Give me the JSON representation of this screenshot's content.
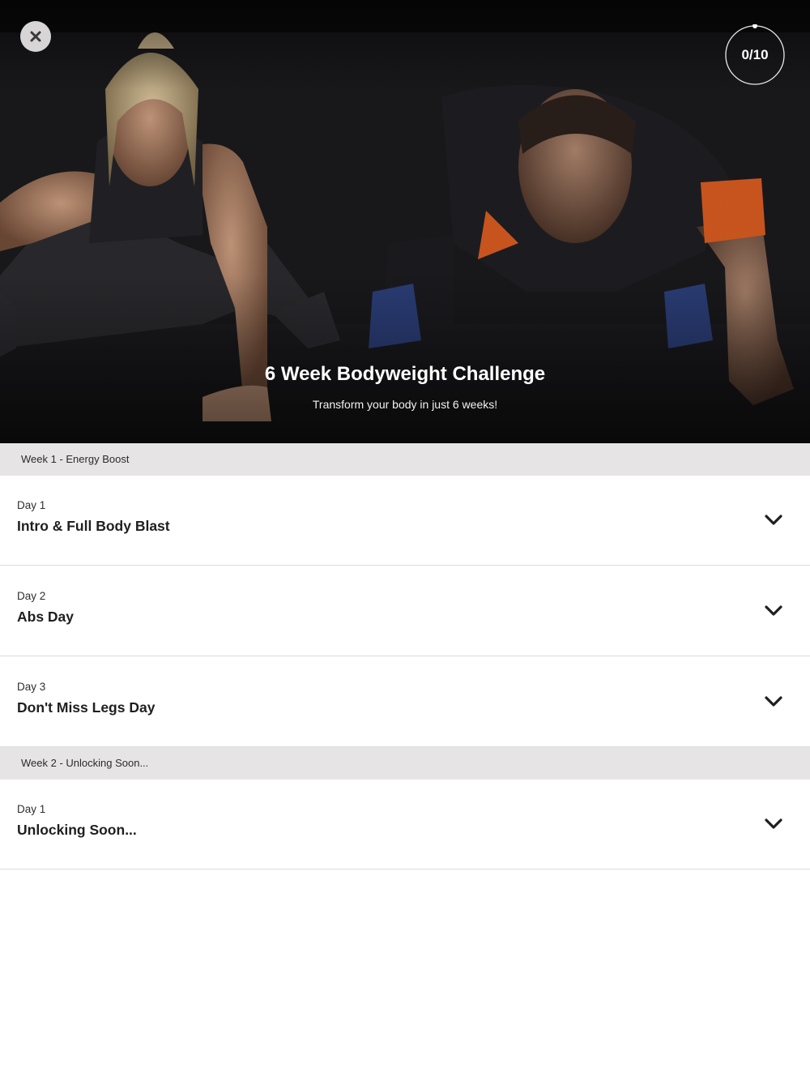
{
  "header": {
    "progress_label": "0/10",
    "progress_fraction": 0,
    "title": "6 Week Bodyweight Challenge",
    "subtitle": "Transform your body in just 6 weeks!",
    "close_icon": "close-icon",
    "hero_image": "two people doing push-ups on dark background"
  },
  "weeks": [
    {
      "label": "Week 1 - Energy Boost",
      "days": [
        {
          "day": "Day 1",
          "title": "Intro & Full Body Blast",
          "icon": "chevron-down-icon"
        },
        {
          "day": "Day 2",
          "title": "Abs Day",
          "icon": "chevron-down-icon"
        },
        {
          "day": "Day 3",
          "title": "Don't Miss Legs Day",
          "icon": "chevron-down-icon"
        }
      ]
    },
    {
      "label": "Week 2 - Unlocking Soon...",
      "days": [
        {
          "day": "Day 1",
          "title": "Unlocking Soon...",
          "icon": "chevron-down-icon"
        }
      ]
    }
  ],
  "colors": {
    "hero_background": "#0c0c0e",
    "week_header_bg": "#e7e4e5",
    "row_divider": "#dcdcdc",
    "text_primary": "#1f1f1f",
    "close_button_bg": "#d7d5d6"
  }
}
